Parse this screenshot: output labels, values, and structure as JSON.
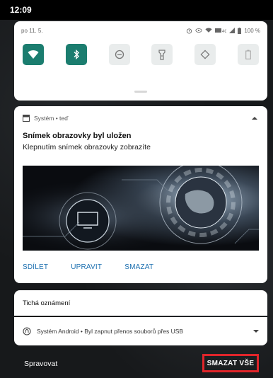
{
  "statusbar": {
    "time": "12:09"
  },
  "quick_settings": {
    "date": "po 11. 5.",
    "battery": "100 %",
    "tiles": [
      {
        "icon": "wifi-icon",
        "state": "on"
      },
      {
        "icon": "bluetooth-icon",
        "state": "on"
      },
      {
        "icon": "do-not-disturb-icon",
        "state": "off"
      },
      {
        "icon": "flashlight-icon",
        "state": "off"
      },
      {
        "icon": "auto-rotate-icon",
        "state": "off"
      },
      {
        "icon": "battery-saver-icon",
        "state": "off"
      }
    ]
  },
  "notification": {
    "app": "Systém • teď",
    "title": "Snímek obrazovky byl uložen",
    "text": "Klepnutím snímek obrazovky zobrazíte",
    "actions": {
      "share": "SDÍLET",
      "edit": "UPRAVIT",
      "delete": "SMAZAT"
    }
  },
  "silent": {
    "header": "Tichá oznámení",
    "item": "Systém Android • Byl zapnut přenos souborů přes USB"
  },
  "footer": {
    "manage": "Spravovat",
    "clear_all": "SMAZAT VŠE"
  },
  "colors": {
    "accent": "#1b7d6f",
    "link": "#1b6fb0",
    "highlight": "#e0252a"
  }
}
